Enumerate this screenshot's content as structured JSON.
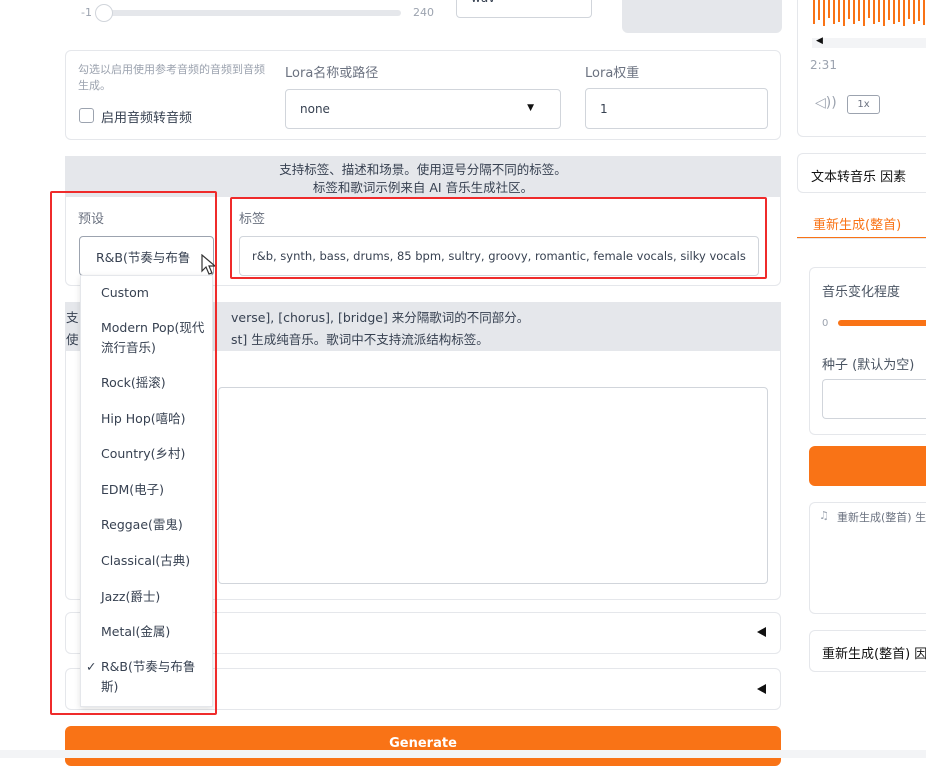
{
  "top": {
    "slider_min": "-1",
    "slider_max": "240",
    "format_value": "wav"
  },
  "lora": {
    "checkbox_hint": "勾选以启用使用参考音频的音频到音频生成。",
    "checkbox_label": "启用音频转音频",
    "name_label": "Lora名称或路径",
    "name_value": "none",
    "weight_label": "Lora权重",
    "weight_value": "1"
  },
  "tags_info": {
    "line1": "支持标签、描述和场景。使用逗号分隔不同的标签。",
    "line2": "标签和歌词示例来自 AI 音乐生成社区。"
  },
  "preset": {
    "label": "预设",
    "value": "R&B(节奏与布鲁"
  },
  "tags": {
    "label": "标签",
    "value": "r&b, synth, bass, drums, 85 bpm, sultry, groovy, romantic, female vocals, silky vocals"
  },
  "lyrics_info": {
    "line1_prefix": "支",
    "line1_rest": "verse], [chorus], [bridge] 来分隔歌词的不同部分。",
    "line2_prefix": "使",
    "line2_rest": "st] 生成纯音乐。歌词中不支持流派结构标签。"
  },
  "dropdown": {
    "items": [
      {
        "label": "Custom"
      },
      {
        "label": "Modern Pop(现代流行音乐)"
      },
      {
        "label": "Rock(摇滚)"
      },
      {
        "label": "Hip Hop(嘻哈)"
      },
      {
        "label": "Country(乡村)"
      },
      {
        "label": "EDM(电子)"
      },
      {
        "label": "Reggae(雷鬼)"
      },
      {
        "label": "Classical(古典)"
      },
      {
        "label": "Jazz(爵士)"
      },
      {
        "label": "Metal(金属)"
      },
      {
        "label": "R&B(节奏与布鲁斯)"
      }
    ],
    "checkmark": "✓",
    "selected_index": 10
  },
  "generate_label": "Generate",
  "right": {
    "time": "2:31",
    "speed": "1x",
    "tab_text2music": "文本转音乐 因素",
    "tab_regenerate": "重新生成(整首)",
    "variance_label": "音乐变化程度",
    "variance_min": "0",
    "seed_label": "种子 (默认为空)",
    "output_label": "重新生成(整首) 生",
    "regen_label": "重新生成(整首) 因"
  },
  "colors": {
    "accent": "#f97316",
    "highlight": "#ef2b2b",
    "band": "#e5e7eb"
  }
}
